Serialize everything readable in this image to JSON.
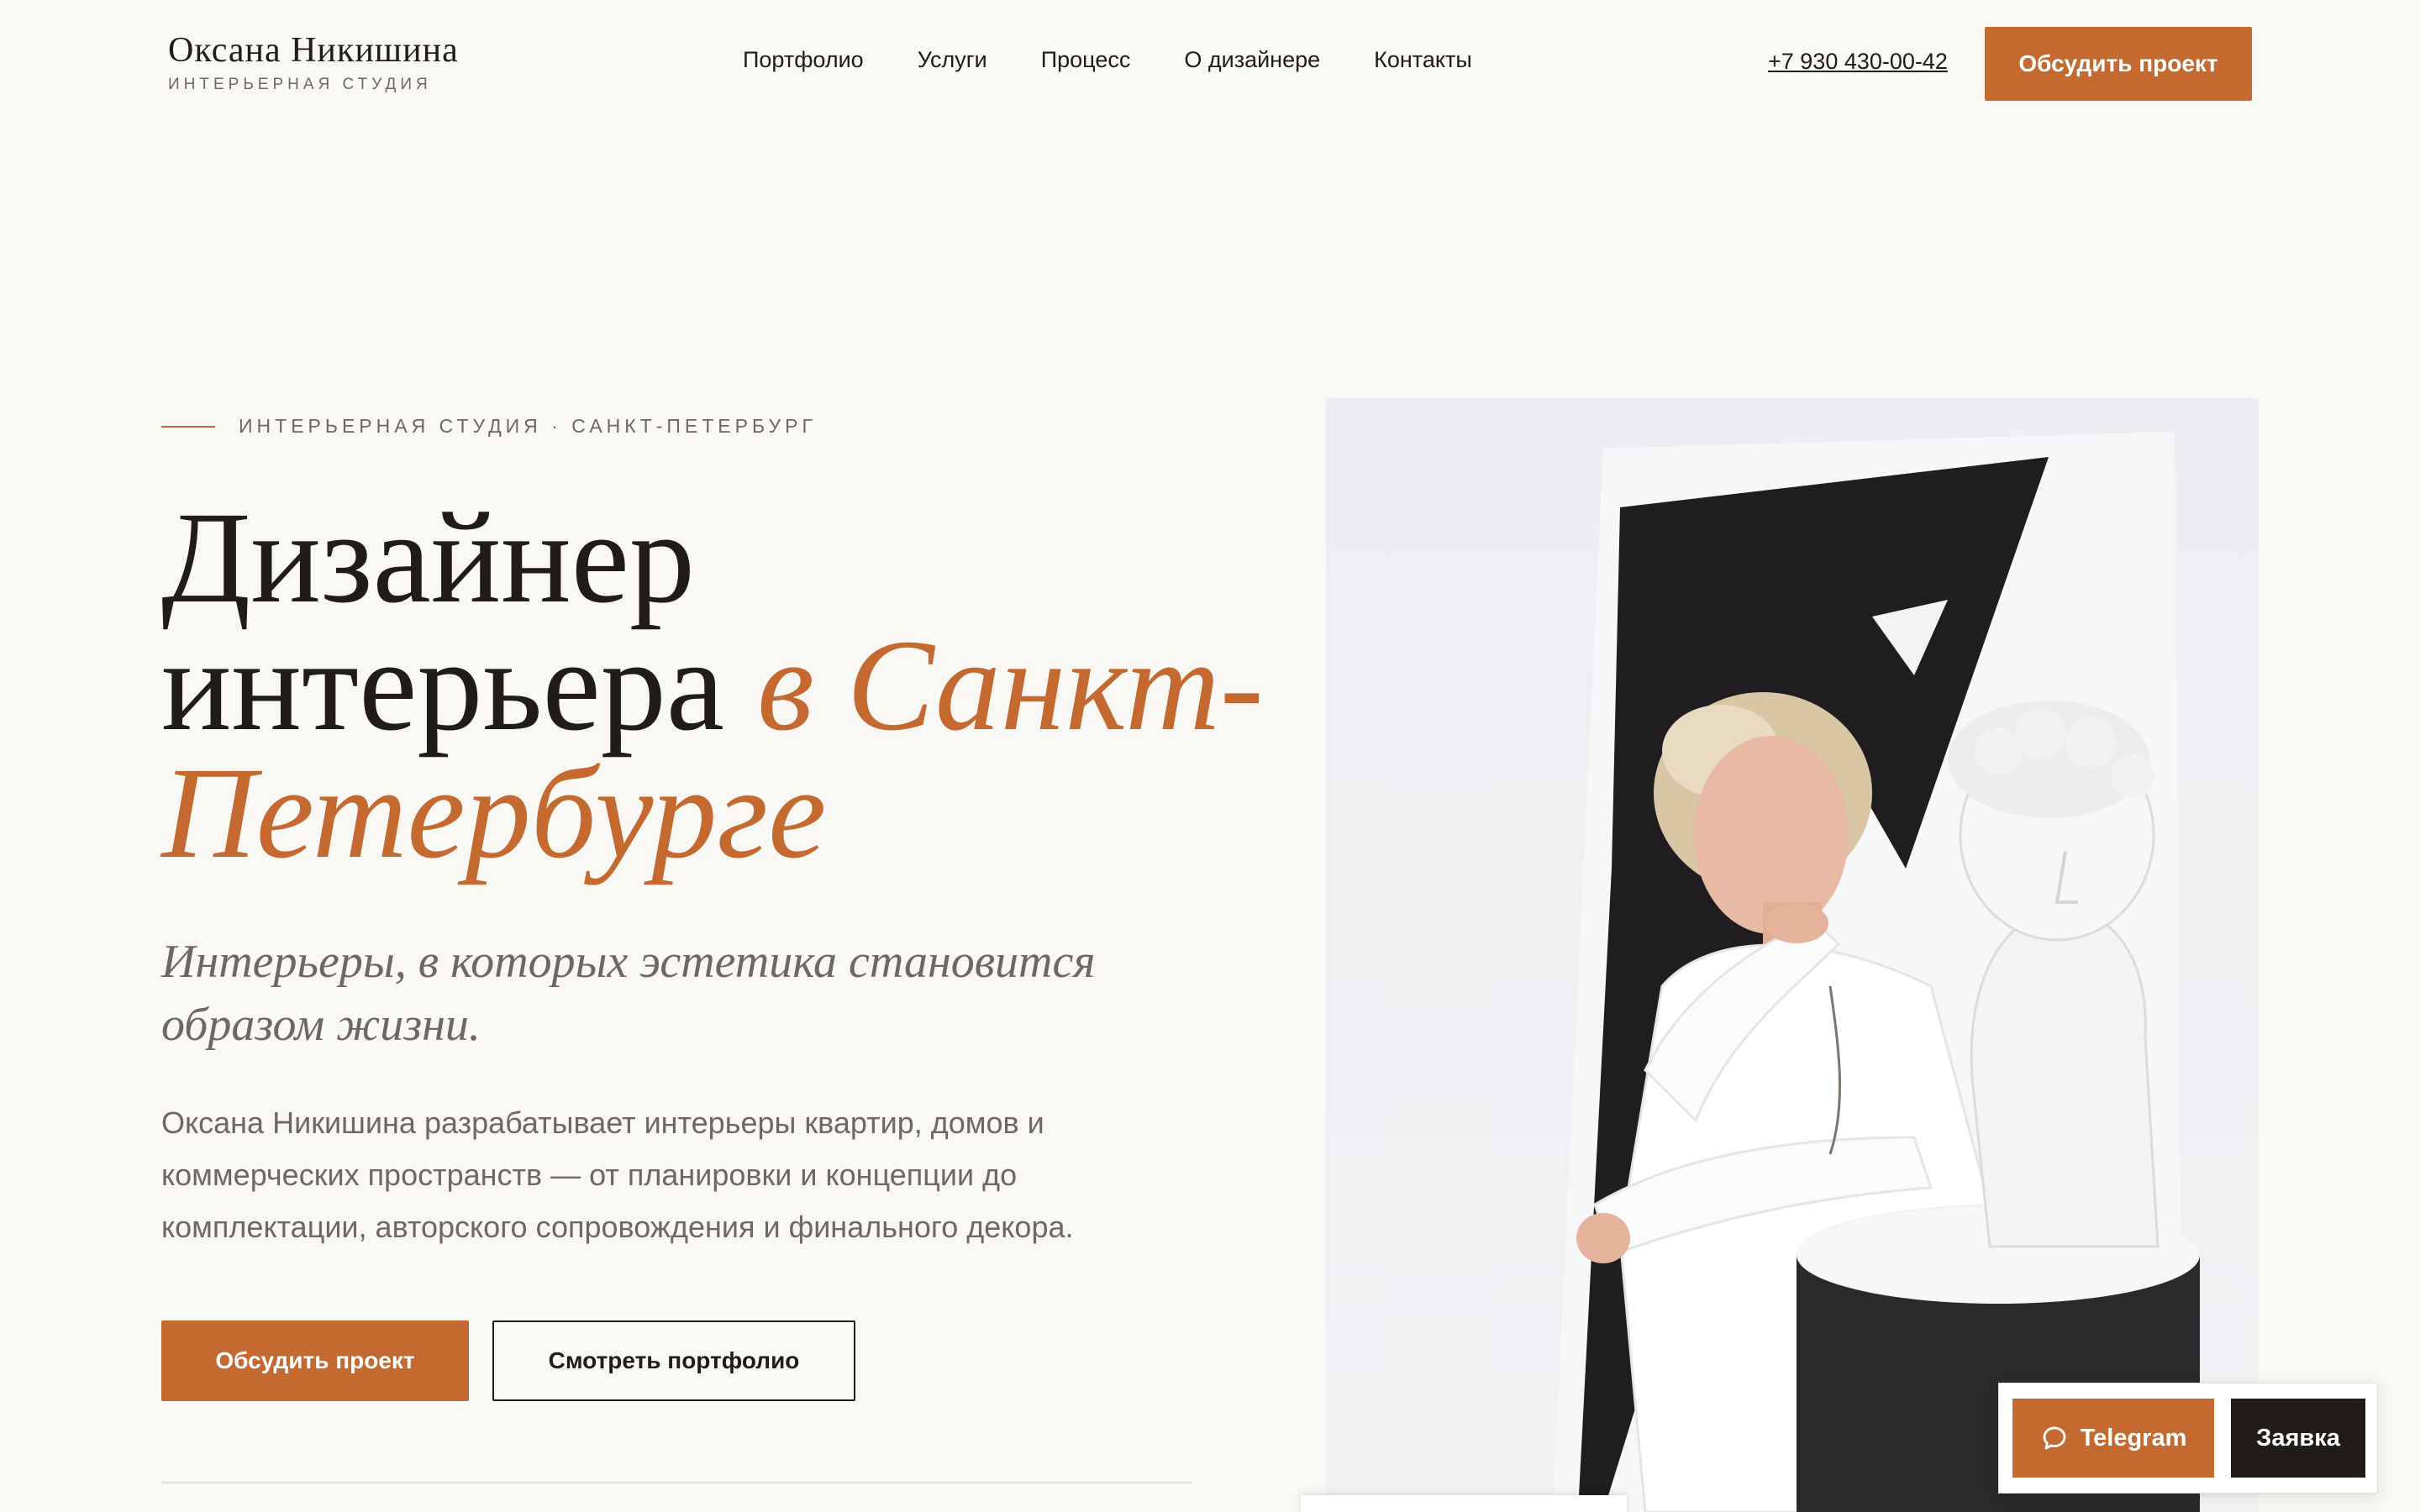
{
  "brand": {
    "name": "Оксана Никишина",
    "subtitle": "ИНТЕРЬЕРНАЯ СТУДИЯ"
  },
  "nav": {
    "items": [
      {
        "label": "Портфолио"
      },
      {
        "label": "Услуги"
      },
      {
        "label": "Процесс"
      },
      {
        "label": "О дизайнере"
      },
      {
        "label": "Контакты"
      }
    ]
  },
  "header": {
    "phone": "+7 930 430-00-42",
    "cta_label": "Обсудить проект"
  },
  "hero": {
    "eyebrow": "ИНТЕРЬЕРНАЯ СТУДИЯ · САНКТ-ПЕТЕРБУРГ",
    "title_plain": "Дизайнер интерьера ",
    "title_accent": "в Санкт-Петербурге",
    "tagline": "Интерьеры, в которых эстетика становится образом жизни.",
    "intro": "Оксана Никишина разрабатывает интерьеры квартир, домов и коммерческих пространств — от планировки и концепции до комплектации, авторского сопровождения и финального декора.",
    "primary_button": "Обсудить проект",
    "secondary_button": "Смотреть портфолио"
  },
  "widget": {
    "telegram_label": "Telegram",
    "request_label": "Заявка"
  },
  "colors": {
    "accent": "#c4692f",
    "background": "#faf8f5",
    "text": "#1f1c19",
    "muted": "#6f6861",
    "dark_button": "#1f1c19"
  },
  "icons": {
    "telegram_button": "chat-bubble-icon"
  }
}
